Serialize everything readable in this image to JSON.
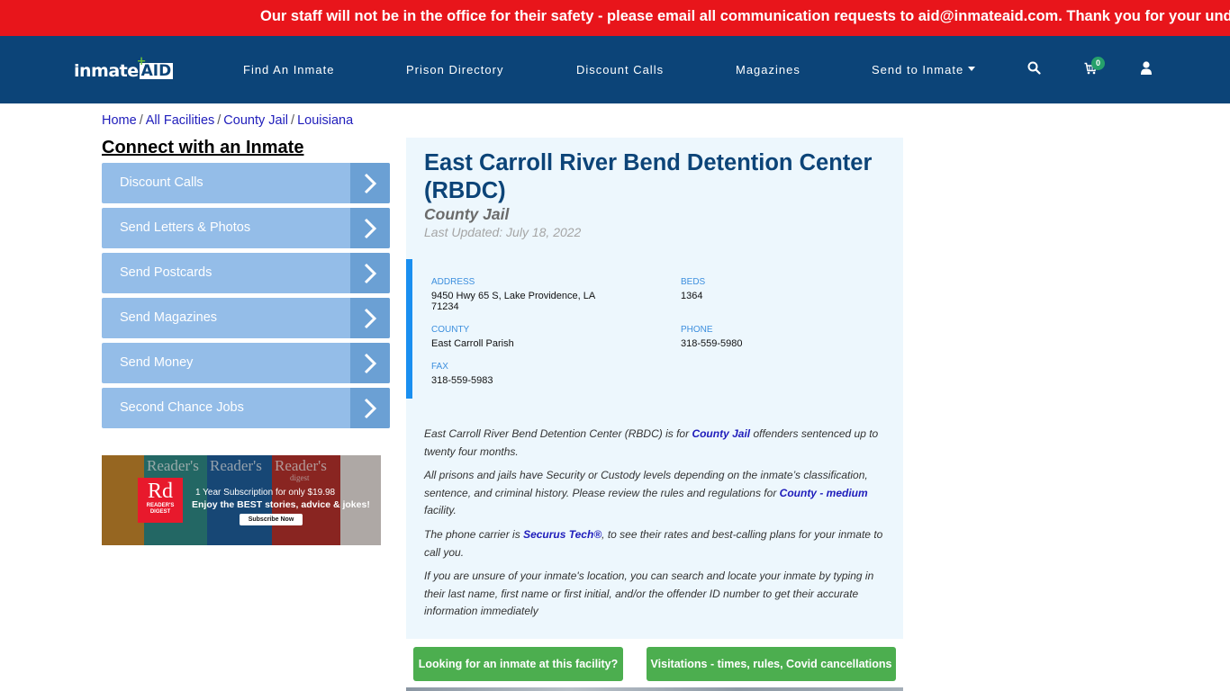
{
  "alert": {
    "text": "Our staff will not be in the office for their safety - please email all communication requests to aid@inmateaid.com. Thank you for your understanding."
  },
  "nav": {
    "logo_main": "inmate",
    "logo_accent": "AID",
    "items": [
      {
        "label": "Find An Inmate"
      },
      {
        "label": "Prison Directory"
      },
      {
        "label": "Discount Calls"
      },
      {
        "label": "Magazines"
      },
      {
        "label": "Send to Inmate",
        "has_dropdown": true
      }
    ],
    "icons": [
      "search-icon",
      "cart-icon",
      "user-icon"
    ],
    "cart_count": "0"
  },
  "breadcrumb": [
    {
      "label": "Home"
    },
    {
      "label": "All Facilities"
    },
    {
      "label": "County Jail"
    },
    {
      "label": "Louisiana"
    }
  ],
  "sidebar": {
    "title": "Connect with an Inmate",
    "items": [
      {
        "label": "Discount Calls"
      },
      {
        "label": "Send Letters & Photos"
      },
      {
        "label": "Send Postcards"
      },
      {
        "label": "Send Magazines"
      },
      {
        "label": "Send Money"
      },
      {
        "label": "Second Chance Jobs"
      }
    ],
    "ad": {
      "brand_short": "Rd",
      "brand_sub": "READER'S DIGEST",
      "cover_title": "Reader's",
      "cover_sub": "digest",
      "line1": "1 Year Subscription for only $19.98",
      "line2": "Enjoy the BEST stories, advice & jokes!",
      "cta": "Subscribe Now"
    }
  },
  "facility": {
    "name": "East Carroll River Bend Detention Center (RBDC)",
    "type": "County Jail",
    "last_updated": "Last Updated: July 18, 2022",
    "info": {
      "address_label": "ADDRESS",
      "address": "9450 Hwy 65 S, Lake Providence, LA 71234",
      "beds_label": "BEDS",
      "beds": "1364",
      "county_label": "COUNTY",
      "county": "East Carroll Parish",
      "phone_label": "PHONE",
      "phone": "318-559-5980",
      "fax_label": "FAX",
      "fax": "318-559-5983"
    },
    "description": {
      "p1_pre": "East Carroll River Bend Detention Center (RBDC) is for ",
      "p1_link": "County Jail",
      "p1_post": " offenders sentenced up to twenty four months.",
      "p2_pre": "All prisons and jails have Security or Custody levels depending on the inmate’s classification, sentence, and criminal history. Please review the rules and regulations for ",
      "p2_link": "County - medium",
      "p2_post": " facility.",
      "p3_pre": "The phone carrier is ",
      "p3_link": "Securus Tech®",
      "p3_post": ", to see their rates and best-calling plans for your inmate to call you.",
      "p4": "If you are unsure of your inmate's location, you can search and locate your inmate by typing in their last name, first name or first initial, and/or the offender ID number to get their accurate information immediately"
    },
    "buttons": {
      "find_inmate": "Looking for an inmate at this facility?",
      "visitation": "Visitations - times, rules, Covid cancellations"
    }
  },
  "colors": {
    "alert_bg": "#e8151b",
    "nav_bg": "#0c4478",
    "sidebar_item": "#94bde8",
    "sidebar_arrow": "#6ba0d4",
    "card_bg": "#edf7fd",
    "accent_blue": "#1a8ff0",
    "cta_green": "#4cae4f",
    "badge_green": "#26a06b"
  }
}
